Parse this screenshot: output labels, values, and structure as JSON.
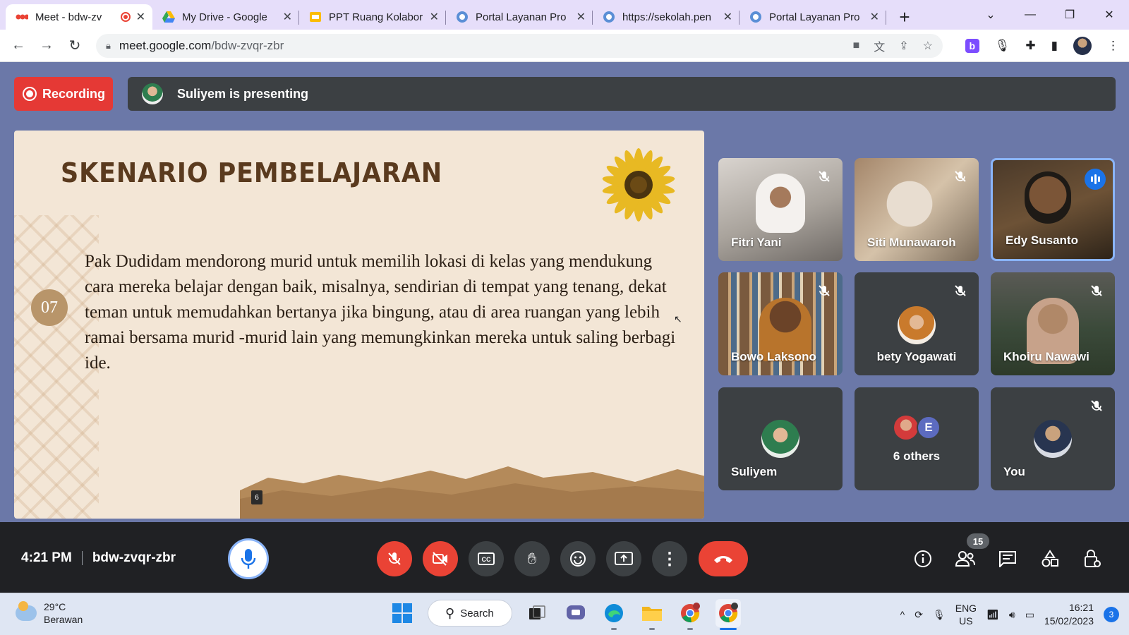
{
  "browser": {
    "tabs": [
      {
        "title": "Meet - bdw-zv",
        "favicon": "meet-icon"
      },
      {
        "title": "My Drive - Google",
        "favicon": "drive-icon"
      },
      {
        "title": "PPT Ruang Kolabor",
        "favicon": "slides-icon"
      },
      {
        "title": "Portal Layanan Pro",
        "favicon": "globe-icon"
      },
      {
        "title": "https://sekolah.pen",
        "favicon": "globe-icon"
      },
      {
        "title": "Portal Layanan Pro",
        "favicon": "globe-icon"
      }
    ],
    "url_host": "meet.google.com",
    "url_path": "/bdw-zvqr-zbr"
  },
  "meet": {
    "recording_label": "Recording",
    "presenting_label": "Suliyem is presenting",
    "slide": {
      "title": "SKENARIO PEMBELAJARAN",
      "number": "07",
      "body": "Pak Dudidam mendorong murid untuk memilih lokasi di kelas yang mendukung cara mereka belajar dengan baik, misalnya, sendirian di tempat yang tenang, dekat teman untuk memudahkan bertanya jika bingung, atau di area ruangan yang lebih ramai bersama murid -murid lain yang memungkinkan mereka untuk saling berbagi ide.",
      "page_tag": "6"
    },
    "participants": [
      {
        "name": "Fitri Yani",
        "muted": true
      },
      {
        "name": "Siti Munawaroh",
        "muted": true
      },
      {
        "name": "Edy Susanto",
        "muted": false,
        "speaking": true
      },
      {
        "name": "Bowo Laksono",
        "muted": true
      },
      {
        "name": "bety Yogawati",
        "muted": true
      },
      {
        "name": "Khoiru Nawawi",
        "muted": true
      },
      {
        "name": "Suliyem",
        "muted": false
      },
      {
        "name": "6 others",
        "others_initial": "E"
      },
      {
        "name": "You",
        "muted": true
      }
    ],
    "time": "4:21 PM",
    "meeting_code": "bdw-zvqr-zbr",
    "people_count": "15"
  },
  "taskbar": {
    "weather_temp": "29°C",
    "weather_desc": "Berawan",
    "search_label": "Search",
    "lang_top": "ENG",
    "lang_bottom": "US",
    "clock_time": "16:21",
    "clock_date": "15/02/2023",
    "notifications": "3"
  },
  "colors": {
    "meet_bg": "#6b78a8",
    "recording_red": "#e53935",
    "control_red": "#ea4335",
    "accent_blue": "#1a73e8"
  }
}
